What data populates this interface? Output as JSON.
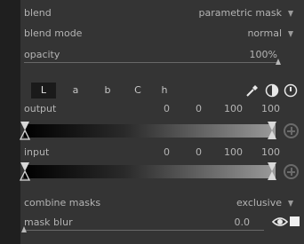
{
  "blend": {
    "label": "blend",
    "value": "parametric mask"
  },
  "blend_mode": {
    "label": "blend mode",
    "value": "normal"
  },
  "opacity": {
    "label": "opacity",
    "value": "100%",
    "level": 1.0
  },
  "channel_tabs": [
    "L",
    "a",
    "b",
    "C",
    "h"
  ],
  "output": {
    "label": "output",
    "values": [
      "0",
      "0",
      "100",
      "100"
    ]
  },
  "input": {
    "label": "input",
    "values": [
      "0",
      "0",
      "100",
      "100"
    ]
  },
  "combine_masks": {
    "label": "combine masks",
    "value": "exclusive"
  },
  "mask_blur": {
    "label": "mask blur",
    "value": "0.0",
    "level": 0.0
  },
  "icons": {
    "picker": "color-picker-icon",
    "invert": "half-circle-invert-icon",
    "reset": "power-reset-icon",
    "add_marker": "plus-circle-icon",
    "show_mask": "eye-icon",
    "mask_square": "square-icon"
  },
  "colors": {
    "panel": "#343434",
    "text": "#b4b4b4",
    "accent": "#ffffff"
  }
}
